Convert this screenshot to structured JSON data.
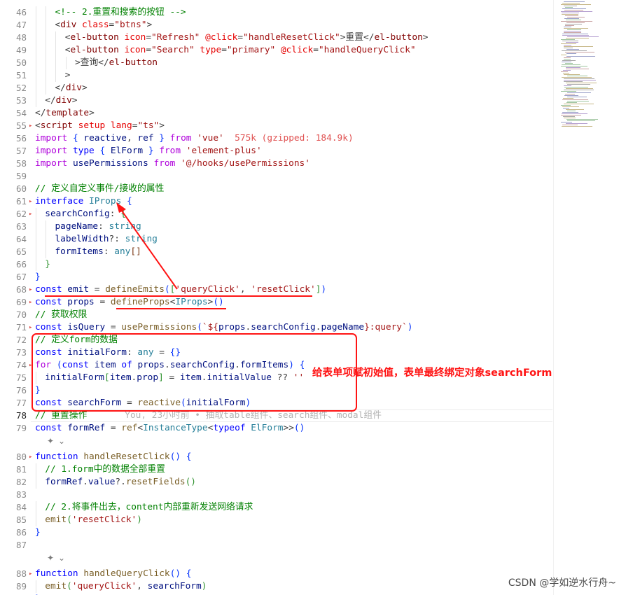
{
  "editor": {
    "active_line": 78,
    "lines": [
      {
        "n": "46",
        "indent": 2,
        "tokens": [
          [
            "cmt",
            "<!-- 2.重置和搜索的按钮 -->"
          ]
        ]
      },
      {
        "n": "47",
        "indent": 2,
        "tokens": [
          [
            "pun",
            "<"
          ],
          [
            "tag",
            "div "
          ],
          [
            "attr",
            "class"
          ],
          [
            "pun",
            "="
          ],
          [
            "str",
            "\"btns\""
          ],
          [
            "pun",
            ">"
          ]
        ]
      },
      {
        "n": "48",
        "indent": 3,
        "tokens": [
          [
            "pun",
            "<"
          ],
          [
            "tag",
            "el-button "
          ],
          [
            "attr",
            "icon"
          ],
          [
            "pun",
            "="
          ],
          [
            "str",
            "\"Refresh\" "
          ],
          [
            "attr",
            "@click"
          ],
          [
            "pun",
            "="
          ],
          [
            "str",
            "\"handleResetClick\""
          ],
          [
            "pun",
            ">重置</"
          ],
          [
            "tag",
            "el-button"
          ],
          [
            "pun",
            ">"
          ]
        ]
      },
      {
        "n": "49",
        "indent": 3,
        "tokens": [
          [
            "pun",
            "<"
          ],
          [
            "tag",
            "el-button "
          ],
          [
            "attr",
            "icon"
          ],
          [
            "pun",
            "="
          ],
          [
            "str",
            "\"Search\" "
          ],
          [
            "attr",
            "type"
          ],
          [
            "pun",
            "="
          ],
          [
            "str",
            "\"primary\" "
          ],
          [
            "attr",
            "@click"
          ],
          [
            "pun",
            "="
          ],
          [
            "str",
            "\"handleQueryClick\""
          ]
        ]
      },
      {
        "n": "50",
        "indent": 4,
        "tokens": [
          [
            "pun",
            ">查询</"
          ],
          [
            "tag",
            "el-button"
          ]
        ]
      },
      {
        "n": "51",
        "indent": 3,
        "tokens": [
          [
            "pun",
            ">"
          ]
        ]
      },
      {
        "n": "52",
        "indent": 2,
        "tokens": [
          [
            "pun",
            "</"
          ],
          [
            "tag",
            "div"
          ],
          [
            "pun",
            ">"
          ]
        ]
      },
      {
        "n": "53",
        "indent": 1,
        "tokens": [
          [
            "pun",
            "</"
          ],
          [
            "tag",
            "div"
          ],
          [
            "pun",
            ">"
          ]
        ]
      },
      {
        "n": "54",
        "indent": 0,
        "tokens": [
          [
            "pun",
            "</"
          ],
          [
            "tag",
            "template"
          ],
          [
            "pun",
            ">"
          ]
        ]
      },
      {
        "n": "55",
        "indent": 0,
        "tokens": [
          [
            "pun",
            "<"
          ],
          [
            "tag",
            "script "
          ],
          [
            "attr",
            "setup "
          ],
          [
            "attr",
            "lang"
          ],
          [
            "pun",
            "="
          ],
          [
            "str",
            "\"ts\""
          ],
          [
            "pun",
            ">"
          ]
        ]
      },
      {
        "n": "56",
        "indent": 0,
        "tokens": [
          [
            "ctl",
            "import "
          ],
          [
            "br1",
            "{ "
          ],
          [
            "var",
            "reactive"
          ],
          [
            "pun",
            ", "
          ],
          [
            "var",
            "ref "
          ],
          [
            "br1",
            "} "
          ],
          [
            "ctl",
            "from "
          ],
          [
            "str",
            "'vue'"
          ],
          [
            "pun",
            "  "
          ],
          [
            "size",
            "575k (gzipped: 184.9k)"
          ]
        ]
      },
      {
        "n": "57",
        "indent": 0,
        "tokens": [
          [
            "ctl",
            "import "
          ],
          [
            "kw",
            "type "
          ],
          [
            "br1",
            "{ "
          ],
          [
            "var",
            "ElForm "
          ],
          [
            "br1",
            "} "
          ],
          [
            "ctl",
            "from "
          ],
          [
            "str",
            "'element-plus'"
          ]
        ]
      },
      {
        "n": "58",
        "indent": 0,
        "tokens": [
          [
            "ctl",
            "import "
          ],
          [
            "var",
            "usePermissions "
          ],
          [
            "ctl",
            "from "
          ],
          [
            "str",
            "'@/hooks/usePermissions'"
          ]
        ]
      },
      {
        "n": "59",
        "indent": 0,
        "tokens": []
      },
      {
        "n": "60",
        "indent": 0,
        "tokens": [
          [
            "cmt",
            "// 定义自定义事件/接收的属性"
          ]
        ]
      },
      {
        "n": "61",
        "indent": 0,
        "tokens": [
          [
            "kw",
            "interface "
          ],
          [
            "type",
            "IProps "
          ],
          [
            "br1",
            "{"
          ]
        ]
      },
      {
        "n": "62",
        "indent": 1,
        "tokens": [
          [
            "var",
            "searchConfig"
          ],
          [
            "pun",
            ": "
          ],
          [
            "br2",
            "{"
          ]
        ]
      },
      {
        "n": "63",
        "indent": 2,
        "tokens": [
          [
            "var",
            "pageName"
          ],
          [
            "pun",
            ": "
          ],
          [
            "type",
            "string"
          ]
        ]
      },
      {
        "n": "64",
        "indent": 2,
        "tokens": [
          [
            "var",
            "labelWidth"
          ],
          [
            "pun",
            "?: "
          ],
          [
            "type",
            "string"
          ]
        ]
      },
      {
        "n": "65",
        "indent": 2,
        "tokens": [
          [
            "var",
            "formItems"
          ],
          [
            "pun",
            ": "
          ],
          [
            "type",
            "any"
          ],
          [
            "br3",
            "[]"
          ]
        ]
      },
      {
        "n": "66",
        "indent": 1,
        "tokens": [
          [
            "br2",
            "}"
          ]
        ]
      },
      {
        "n": "67",
        "indent": 0,
        "tokens": [
          [
            "br1",
            "}"
          ]
        ]
      },
      {
        "n": "68",
        "indent": 0,
        "tokens": [
          [
            "kw",
            "const "
          ],
          [
            "var",
            "emit "
          ],
          [
            "pun",
            "= "
          ],
          [
            "fn",
            "defineEmits"
          ],
          [
            "br1",
            "("
          ],
          [
            "br2",
            "["
          ],
          [
            "str",
            "'queryClick'"
          ],
          [
            "pun",
            ", "
          ],
          [
            "str",
            "'resetClick'"
          ],
          [
            "br2",
            "]"
          ],
          [
            "br1",
            ")"
          ]
        ]
      },
      {
        "n": "69",
        "indent": 0,
        "tokens": [
          [
            "kw",
            "const "
          ],
          [
            "var",
            "props "
          ],
          [
            "pun",
            "= "
          ],
          [
            "fn",
            "defineProps"
          ],
          [
            "pun",
            "<"
          ],
          [
            "type",
            "IProps"
          ],
          [
            "pun",
            ">"
          ],
          [
            "br1",
            "()"
          ]
        ]
      },
      {
        "n": "70",
        "indent": 0,
        "tokens": [
          [
            "cmt",
            "// 获取权限"
          ]
        ]
      },
      {
        "n": "71",
        "indent": 0,
        "tokens": [
          [
            "kw",
            "const "
          ],
          [
            "var",
            "isQuery "
          ],
          [
            "pun",
            "= "
          ],
          [
            "fn",
            "usePermissions"
          ],
          [
            "br1",
            "("
          ],
          [
            "str",
            "`${"
          ],
          [
            "var",
            "props"
          ],
          [
            "pun",
            "."
          ],
          [
            "var",
            "searchConfig"
          ],
          [
            "pun",
            "."
          ],
          [
            "var",
            "pageName"
          ],
          [
            "str",
            "}:query`"
          ],
          [
            "br1",
            ")"
          ]
        ]
      },
      {
        "n": "72",
        "indent": 0,
        "tokens": [
          [
            "cmt",
            "// 定义form的数据"
          ]
        ]
      },
      {
        "n": "73",
        "indent": 0,
        "tokens": [
          [
            "kw",
            "const "
          ],
          [
            "var",
            "initialForm"
          ],
          [
            "pun",
            ": "
          ],
          [
            "type",
            "any "
          ],
          [
            "pun",
            "= "
          ],
          [
            "br1",
            "{}"
          ]
        ]
      },
      {
        "n": "74",
        "indent": 0,
        "tokens": [
          [
            "ctl",
            "for "
          ],
          [
            "br1",
            "("
          ],
          [
            "kw",
            "const "
          ],
          [
            "var",
            "item "
          ],
          [
            "kw",
            "of "
          ],
          [
            "var",
            "props"
          ],
          [
            "pun",
            "."
          ],
          [
            "var",
            "searchConfig"
          ],
          [
            "pun",
            "."
          ],
          [
            "var",
            "formItems"
          ],
          [
            "br1",
            ") "
          ],
          [
            "br1",
            "{"
          ]
        ]
      },
      {
        "n": "75",
        "indent": 1,
        "tokens": [
          [
            "var",
            "initialForm"
          ],
          [
            "br2",
            "["
          ],
          [
            "var",
            "item"
          ],
          [
            "pun",
            "."
          ],
          [
            "var",
            "prop"
          ],
          [
            "br2",
            "] "
          ],
          [
            "pun",
            "= "
          ],
          [
            "var",
            "item"
          ],
          [
            "pun",
            "."
          ],
          [
            "var",
            "initialValue "
          ],
          [
            "pun",
            "?? "
          ],
          [
            "str",
            "''"
          ]
        ]
      },
      {
        "n": "76",
        "indent": 0,
        "tokens": [
          [
            "br1",
            "}"
          ]
        ]
      },
      {
        "n": "77",
        "indent": 0,
        "tokens": [
          [
            "kw",
            "const "
          ],
          [
            "var",
            "searchForm "
          ],
          [
            "pun",
            "= "
          ],
          [
            "fn",
            "reactive"
          ],
          [
            "br1",
            "("
          ],
          [
            "var",
            "initialForm"
          ],
          [
            "br1",
            ")"
          ]
        ]
      },
      {
        "n": "78",
        "indent": 0,
        "tokens": [
          [
            "cmt",
            "// 重置操作"
          ],
          [
            "pun",
            "       "
          ],
          [
            "blame",
            "You, 23小时前 • 抽取table组件、search组件、modal组件"
          ]
        ]
      },
      {
        "n": "79",
        "indent": 0,
        "tokens": [
          [
            "kw",
            "const "
          ],
          [
            "var",
            "formRef "
          ],
          [
            "pun",
            "= "
          ],
          [
            "fn",
            "ref"
          ],
          [
            "pun",
            "<"
          ],
          [
            "type",
            "InstanceType"
          ],
          [
            "pun",
            "<"
          ],
          [
            "kw",
            "typeof "
          ],
          [
            "type",
            "ElForm"
          ],
          [
            "pun",
            ">>"
          ],
          [
            "br1",
            "()"
          ]
        ]
      },
      {
        "n": "80",
        "indent": 0,
        "tokens": [
          [
            "kw",
            "function "
          ],
          [
            "fn",
            "handleResetClick"
          ],
          [
            "br1",
            "() "
          ],
          [
            "br1",
            "{"
          ]
        ]
      },
      {
        "n": "81",
        "indent": 1,
        "tokens": [
          [
            "cmt",
            "// 1.form中的数据全部重置"
          ]
        ]
      },
      {
        "n": "82",
        "indent": 1,
        "tokens": [
          [
            "var",
            "formRef"
          ],
          [
            "pun",
            "."
          ],
          [
            "var",
            "value"
          ],
          [
            "pun",
            "?."
          ],
          [
            "fn",
            "resetFields"
          ],
          [
            "br2",
            "()"
          ]
        ]
      },
      {
        "n": "83",
        "indent": 0,
        "tokens": []
      },
      {
        "n": "84",
        "indent": 1,
        "tokens": [
          [
            "cmt",
            "// 2.将事件出去，content内部重新发送网络请求"
          ]
        ]
      },
      {
        "n": "85",
        "indent": 1,
        "tokens": [
          [
            "fn",
            "emit"
          ],
          [
            "br2",
            "("
          ],
          [
            "str",
            "'resetClick'"
          ],
          [
            "br2",
            ")"
          ]
        ]
      },
      {
        "n": "86",
        "indent": 0,
        "tokens": [
          [
            "br1",
            "}"
          ]
        ]
      },
      {
        "n": "87",
        "indent": 0,
        "tokens": []
      },
      {
        "n": "88",
        "indent": 0,
        "tokens": [
          [
            "kw",
            "function "
          ],
          [
            "fn",
            "handleQueryClick"
          ],
          [
            "br1",
            "() "
          ],
          [
            "br1",
            "{"
          ]
        ]
      },
      {
        "n": "89",
        "indent": 1,
        "tokens": [
          [
            "fn",
            "emit"
          ],
          [
            "br2",
            "("
          ],
          [
            "str",
            "'queryClick'"
          ],
          [
            "pun",
            ", "
          ],
          [
            "var",
            "searchForm"
          ],
          [
            "br2",
            ")"
          ]
        ]
      },
      {
        "n": "90",
        "indent": 0,
        "tokens": [
          [
            "br1",
            "}"
          ]
        ]
      }
    ]
  },
  "annotation": {
    "callout_text": "给表单项赋初始值，表单最终绑定对象searchForm",
    "color": "#ff1414"
  },
  "watermark": "CSDN @学如逆水行舟~",
  "colors": {
    "keyword": "#0000ff",
    "control": "#af00db",
    "tag": "#800000",
    "attribute": "#e50000",
    "string": "#a31515",
    "comment": "#008000",
    "variable": "#001080",
    "function": "#795e26",
    "type": "#267f99"
  }
}
